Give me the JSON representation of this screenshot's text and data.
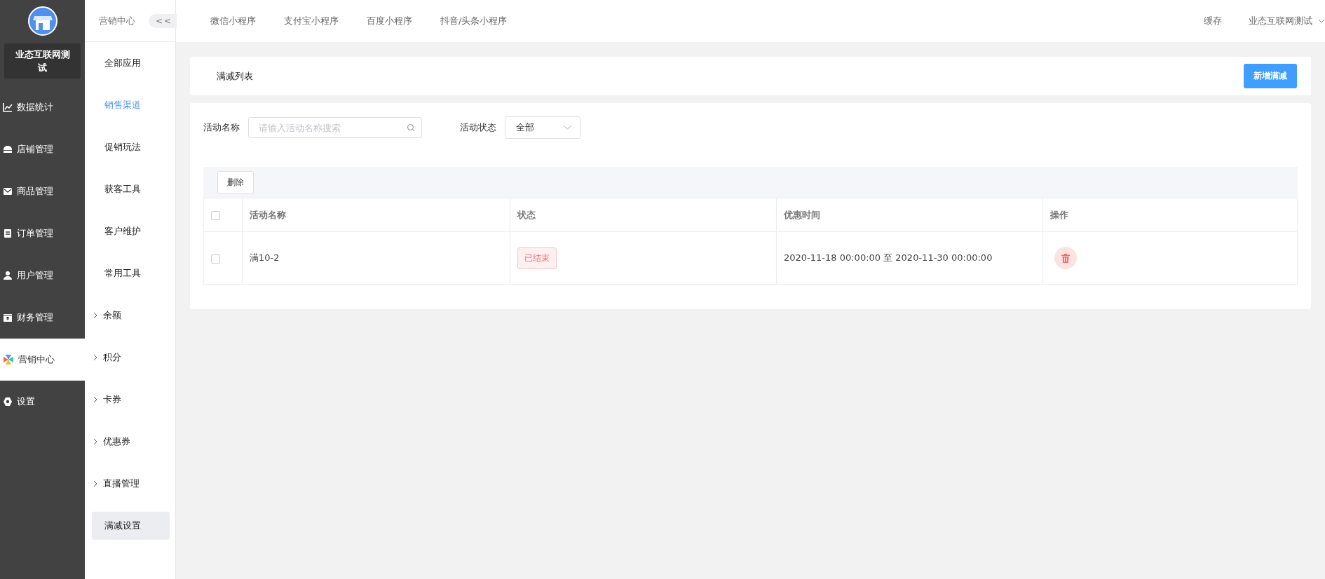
{
  "sidebar": {
    "brand": "业态互联网测试",
    "items": [
      {
        "label": "数据统计",
        "selected": false
      },
      {
        "label": "店铺管理",
        "selected": false
      },
      {
        "label": "商品管理",
        "selected": false
      },
      {
        "label": "订单管理",
        "selected": false
      },
      {
        "label": "用户管理",
        "selected": false
      },
      {
        "label": "财务管理",
        "selected": false
      },
      {
        "label": "营销中心",
        "selected": true
      },
      {
        "label": "设置",
        "selected": false
      }
    ]
  },
  "subnav": {
    "title": "营销中心",
    "collapse": "<<",
    "items": [
      {
        "label": "全部应用",
        "kind": "link",
        "highlighted": false,
        "selected": false
      },
      {
        "label": "销售渠道",
        "kind": "link",
        "highlighted": true,
        "selected": false
      },
      {
        "label": "促销玩法",
        "kind": "link",
        "highlighted": false,
        "selected": false
      },
      {
        "label": "获客工具",
        "kind": "link",
        "highlighted": false,
        "selected": false
      },
      {
        "label": "客户维护",
        "kind": "link",
        "highlighted": false,
        "selected": false
      },
      {
        "label": "常用工具",
        "kind": "link",
        "highlighted": false,
        "selected": false
      },
      {
        "label": "余额",
        "kind": "group",
        "highlighted": false,
        "selected": false
      },
      {
        "label": "积分",
        "kind": "group",
        "highlighted": false,
        "selected": false
      },
      {
        "label": "卡券",
        "kind": "group",
        "highlighted": false,
        "selected": false
      },
      {
        "label": "优惠券",
        "kind": "group",
        "highlighted": false,
        "selected": false
      },
      {
        "label": "直播管理",
        "kind": "group",
        "highlighted": false,
        "selected": false
      },
      {
        "label": "满减设置",
        "kind": "link",
        "highlighted": false,
        "selected": true
      }
    ]
  },
  "top_tabs": [
    "微信小程序",
    "支付宝小程序",
    "百度小程序",
    "抖音/头条小程序"
  ],
  "header_actions": {
    "cache": "缓存",
    "account": "业态互联网测试"
  },
  "page": {
    "title": "满减列表",
    "add_button": "新增满减"
  },
  "filters": {
    "name_label": "活动名称",
    "name_placeholder": "请输入活动名称搜索",
    "status_label": "活动状态",
    "status_value": "全部"
  },
  "table": {
    "delete_button": "删除",
    "select_all_checked": false,
    "columns": [
      "活动名称",
      "状态",
      "优惠时间",
      "操作"
    ],
    "rows": [
      {
        "checked": false,
        "name": "满10-2",
        "status": "已结束",
        "time": "2020-11-18 00:00:00 至 2020-11-30 00:00:00"
      }
    ]
  }
}
